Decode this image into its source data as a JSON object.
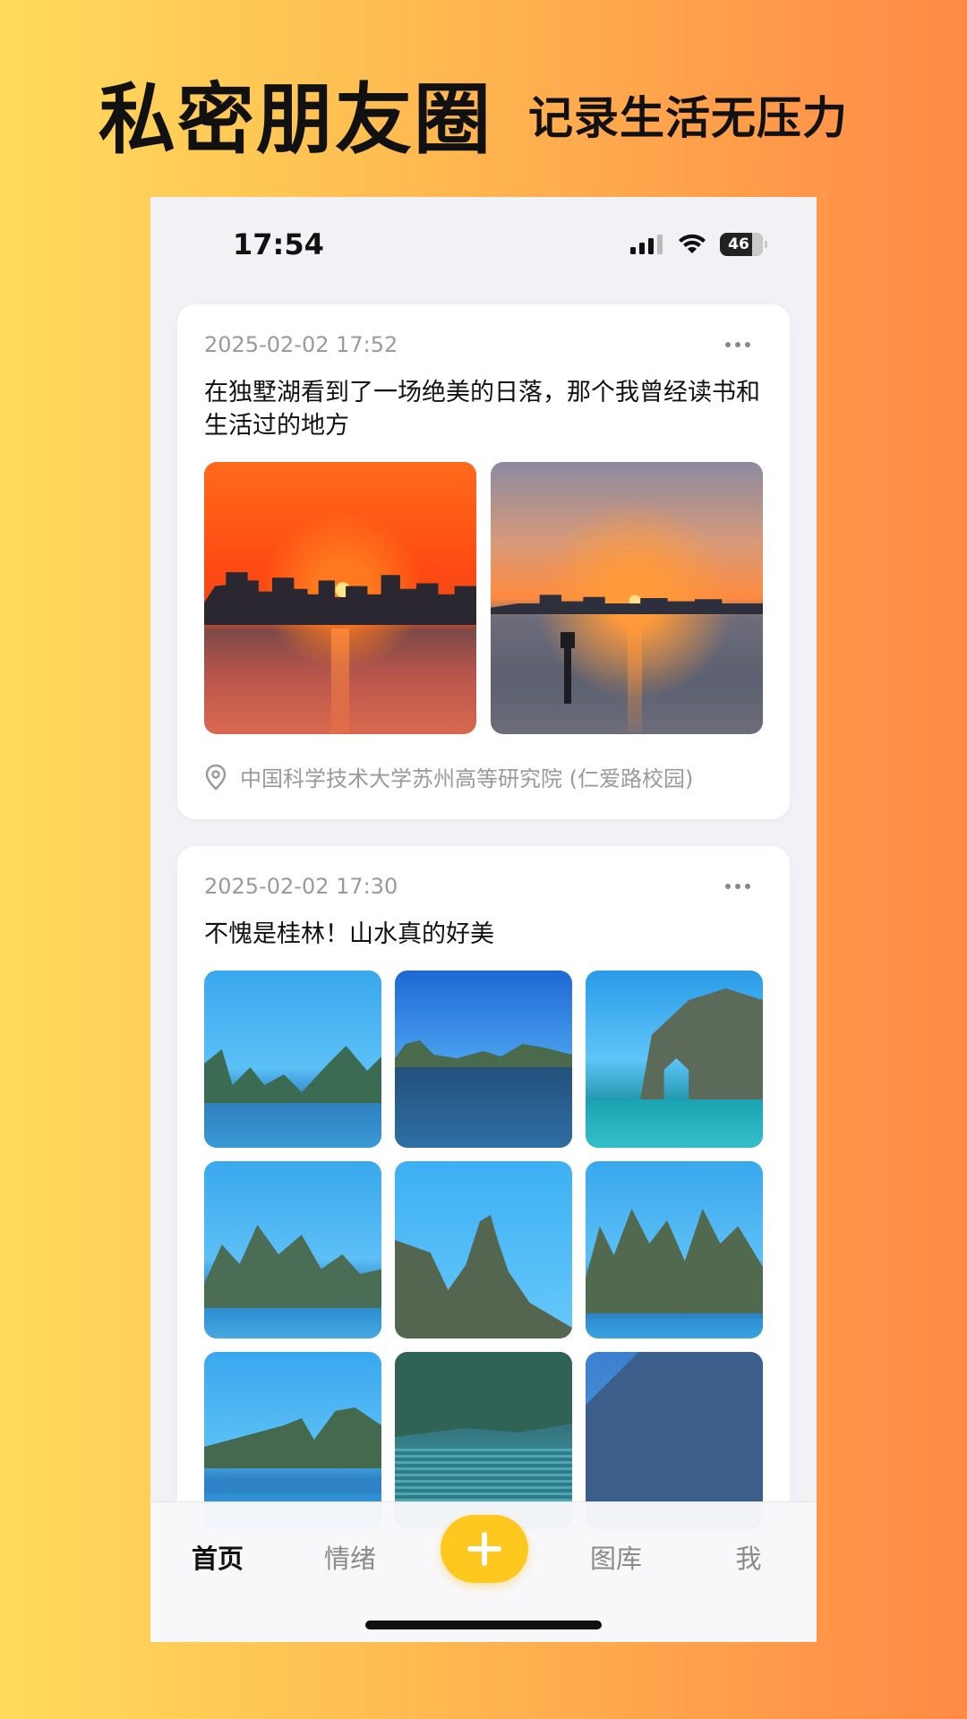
{
  "promo": {
    "title": "私密朋友圈",
    "subtitle": "记录生活无压力"
  },
  "status_bar": {
    "time": "17:54",
    "battery": "46"
  },
  "posts": [
    {
      "date": "2025-02-02 17:52",
      "text": "在独墅湖看到了一场绝美的日落，那个我曾经读书和生活过的地方",
      "photo_count": 2,
      "location": "中国科学技术大学苏州高等研究院 (仁爱路校园)"
    },
    {
      "date": "2025-02-02 17:30",
      "text": "不愧是桂林！山水真的好美",
      "photo_count": 9
    }
  ],
  "tabbar": {
    "home": "首页",
    "mood": "情绪",
    "gallery": "图库",
    "me": "我"
  },
  "colors": {
    "accent": "#ffc81e",
    "bg_gradient_start": "#ffdb5c",
    "bg_gradient_end": "#ff8a46"
  }
}
